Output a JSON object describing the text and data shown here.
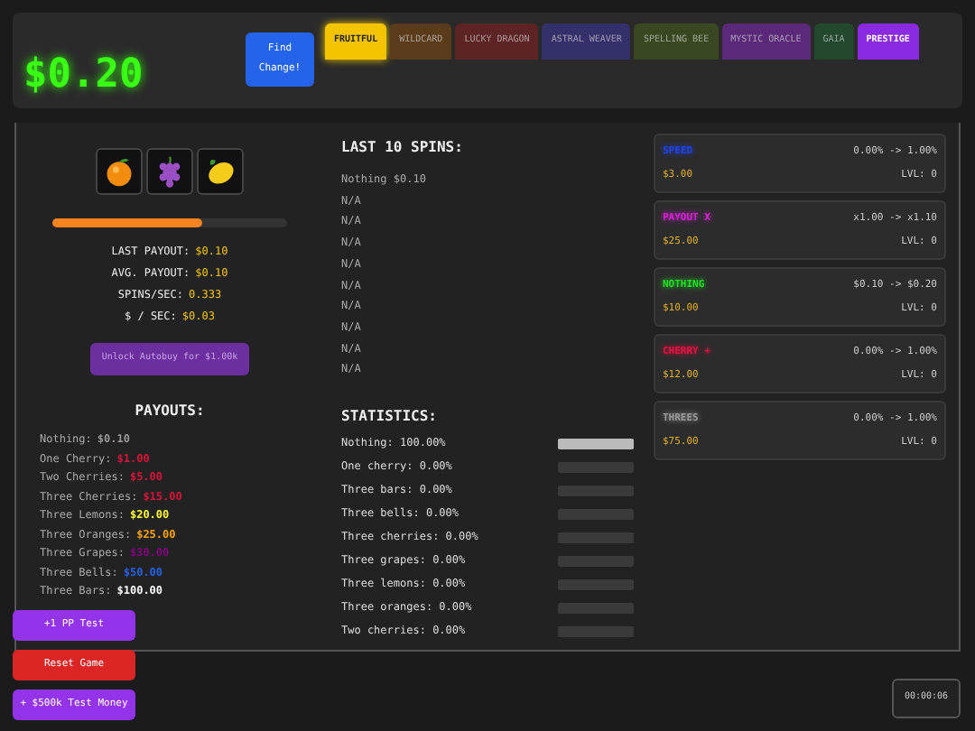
{
  "balance": "$0.20",
  "find_change_button": "Find Change!",
  "tabs": [
    {
      "label": "FRUITFUL",
      "selected": true,
      "color": "#f5c400"
    },
    {
      "label": "WILDCARD",
      "selected": false,
      "color": "#5a3b1c"
    },
    {
      "label": "LUCKY DRAGON",
      "selected": false,
      "color": "#5c2424"
    },
    {
      "label": "ASTRAL WEAVER",
      "selected": false,
      "color": "#34306a"
    },
    {
      "label": "SPELLING BEE",
      "selected": false,
      "color": "#3a4822"
    },
    {
      "label": "MYSTIC ORACLE",
      "selected": false,
      "color": "#5a2a78"
    },
    {
      "label": "GAIA",
      "selected": false,
      "color": "#22482e"
    },
    {
      "label": "PRESTIGE",
      "selected": false,
      "color": "#8a2be2"
    }
  ],
  "reels": [
    {
      "kind": "orange"
    },
    {
      "kind": "grapes"
    },
    {
      "kind": "lemon"
    }
  ],
  "spin_progress": {
    "level": 0.64
  },
  "stats": [
    {
      "label": "LAST PAYOUT:",
      "value": "$0.10"
    },
    {
      "label": "AVG. PAYOUT:",
      "value": "$0.10"
    },
    {
      "label": "SPINS/SEC:",
      "value": "0.333"
    },
    {
      "label": "$ / SEC:",
      "value": "$0.03"
    }
  ],
  "unlock_button": "Unlock Autobuy for $1.00k",
  "payouts": {
    "title": "PAYOUTS:",
    "rows": [
      {
        "label": "Nothing:",
        "value": "$0.10",
        "color": "#9a9a9a"
      },
      {
        "label": "One Cherry:",
        "value": "$1.00",
        "color": "#dc143c"
      },
      {
        "label": "Two Cherries:",
        "value": "$5.00",
        "color": "#dc143c"
      },
      {
        "label": "Three Cherries:",
        "value": "$15.00",
        "color": "#dc143c"
      },
      {
        "label": "Three Lemons:",
        "value": "$20.00",
        "color": "#ffff33"
      },
      {
        "label": "Three Oranges:",
        "value": "$25.00",
        "color": "#ffa500"
      },
      {
        "label": "Three Grapes:",
        "value": "$30.00",
        "color": "#800080"
      },
      {
        "label": "Three Bells:",
        "value": "$50.00",
        "color": "#2563eb"
      },
      {
        "label": "Three Bars:",
        "value": "$100.00",
        "color": "#ffffff"
      }
    ]
  },
  "last_spins": {
    "title": "LAST 10 SPINS:",
    "rows": [
      "Nothing $0.10",
      "N/A",
      "N/A",
      "N/A",
      "N/A",
      "N/A",
      "N/A",
      "N/A",
      "N/A",
      "N/A"
    ]
  },
  "statistics": {
    "title": "STATISTICS:",
    "rows": [
      {
        "label": "Nothing: 100.00%",
        "level": 1
      },
      {
        "label": "One cherry: 0.00%",
        "level": 0
      },
      {
        "label": "Three bars: 0.00%",
        "level": 0
      },
      {
        "label": "Three bells: 0.00%",
        "level": 0
      },
      {
        "label": "Three cherries: 0.00%",
        "level": 0
      },
      {
        "label": "Three grapes: 0.00%",
        "level": 0
      },
      {
        "label": "Three lemons: 0.00%",
        "level": 0
      },
      {
        "label": "Three oranges: 0.00%",
        "level": 0
      },
      {
        "label": "Two cherries: 0.00%",
        "level": 0
      }
    ]
  },
  "upgrades": [
    {
      "name": "SPEED",
      "color": "#2244ee",
      "effect": "0.00% -> 1.00%",
      "cost": "$3.00",
      "level": "LVL: 0"
    },
    {
      "name": "PAYOUT X",
      "color": "#dd22dd",
      "effect": "x1.00 -> x1.10",
      "cost": "$25.00",
      "level": "LVL: 0"
    },
    {
      "name": "NOTHING",
      "color": "#22dd22",
      "effect": "$0.10 -> $0.20",
      "cost": "$10.00",
      "level": "LVL: 0"
    },
    {
      "name": "CHERRY +",
      "color": "#ee1144",
      "effect": "0.00% -> 1.00%",
      "cost": "$12.00",
      "level": "LVL: 0"
    },
    {
      "name": "THREES",
      "color": "#9a9a9a",
      "effect": "0.00% -> 1.00%",
      "cost": "$75.00",
      "level": "LVL: 0"
    }
  ],
  "test_buttons": [
    {
      "label": "+1 PP Test",
      "color": "#9333ea"
    },
    {
      "label": "Reset Game",
      "color": "#dc2626"
    },
    {
      "label": "+ $500k Test Money",
      "color": "#9333ea"
    }
  ],
  "timer": "00:00:06"
}
